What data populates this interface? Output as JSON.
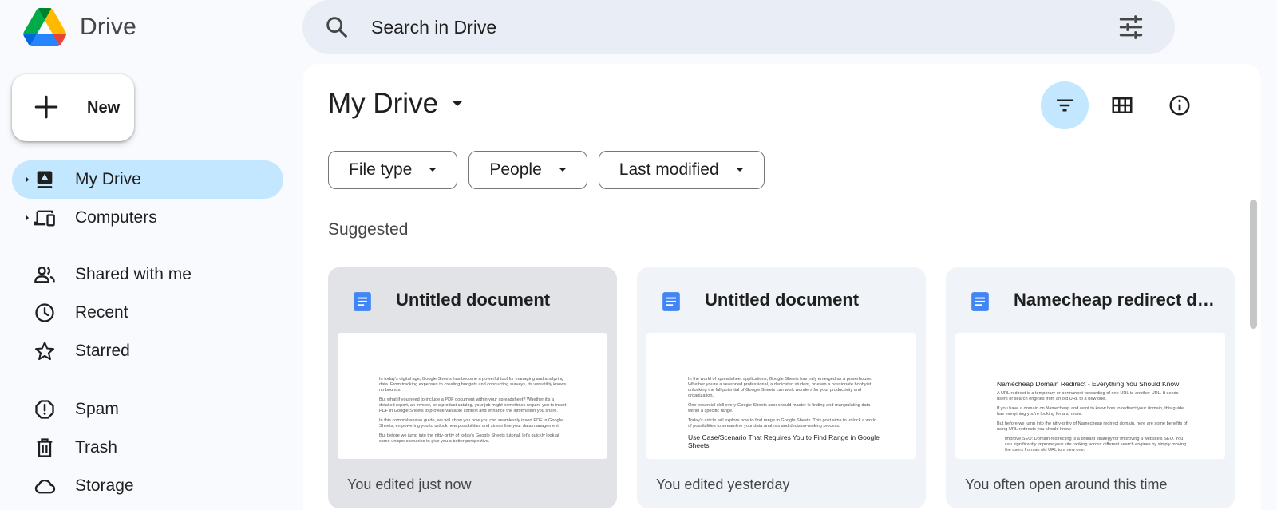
{
  "app": {
    "name": "Drive",
    "logo_icon": "google-drive-logo"
  },
  "search": {
    "placeholder": "Search in Drive",
    "icon": "search-icon",
    "options_icon": "tune-icon"
  },
  "sidebar": {
    "new_label": "New",
    "items": [
      {
        "label": "My Drive",
        "icon": "my-drive-icon",
        "active": true,
        "expandable": true
      },
      {
        "label": "Computers",
        "icon": "computers-icon",
        "active": false,
        "expandable": true
      },
      {
        "label": "Shared with me",
        "icon": "people-icon",
        "active": false
      },
      {
        "label": "Recent",
        "icon": "clock-icon",
        "active": false
      },
      {
        "label": "Starred",
        "icon": "star-icon",
        "active": false
      },
      {
        "label": "Spam",
        "icon": "spam-icon",
        "active": false
      },
      {
        "label": "Trash",
        "icon": "trash-icon",
        "active": false
      },
      {
        "label": "Storage",
        "icon": "cloud-icon",
        "active": false
      }
    ]
  },
  "main": {
    "title": "My Drive",
    "filters": [
      {
        "label": "File type"
      },
      {
        "label": "People"
      },
      {
        "label": "Last modified"
      }
    ],
    "section_label": "Suggested",
    "cards": [
      {
        "title": "Untitled document",
        "meta": "You edited just now",
        "preview": {
          "paragraphs": [
            "In today's digital age, Google Sheets has become a powerful tool for managing and analyzing data. From tracking expenses to creating budgets and conducting surveys, its versatility knows no bounds.",
            "But what if you need to include a PDF document within your spreadsheet? Whether it's a detailed report, an invoice, or a product catalog, your job might sometimes require you to insert PDF in Google Sheets to provide valuable context and enhance the information you share.",
            "In this comprehensive guide, we will show you how you can seamlessly insert PDF in Google Sheets, empowering you to unlock new possibilities and streamline your data management.",
            "But before we jump into the nitty-gritty of today's Google Sheets tutorial, let's quickly look at some unique scenarios to give you a better perspective."
          ]
        }
      },
      {
        "title": "Untitled document",
        "meta": "You edited yesterday",
        "preview": {
          "paragraphs": [
            "In the world of spreadsheet applications, Google Sheets has truly emerged as a powerhouse. Whether you're a seasoned professional, a dedicated student, or even a passionate hobbyist, unlocking the full potential of Google Sheets can work wonders for your productivity and organization.",
            "One essential skill every Google Sheets user should master is finding and manipulating data within a specific range.",
            "Today's article will explore how to find range in Google Sheets. This post aims to unlock a world of possibilities to streamline your data analysis and decision-making process."
          ],
          "heading": "Use Case/Scenario That Requires You to Find Range in Google Sheets"
        }
      },
      {
        "title": "Namecheap redirect do...",
        "meta": "You often open around this time",
        "preview": {
          "heading": "Namecheap Domain Redirect - Everything You Should Know",
          "paragraphs": [
            "A URL redirect is a temporary or permanent forwarding of one URL to another URL. It sends users or search engines from an old URL to a new one.",
            "If you have a domain on Namecheap and want to know how to redirect your domain, this guide has everything you're looking for and more.",
            "But before we jump into the nitty-gritty of Namecheap redirect domain, here are some benefits of using URL redirects you should know:"
          ],
          "bullet": "Improve SEO: Domain redirecting is a brilliant strategy for improving a website's SEO. You can significantly improve your site ranking across different search engines by simply moving the users from an old URL to a new one."
        }
      }
    ]
  },
  "colors": {
    "page_bg": "#f8fafd",
    "search_bg": "#e9eef6",
    "active_nav": "#c2e7ff",
    "card_bg": "#f0f4f9",
    "docs_blue": "#4285f4"
  }
}
